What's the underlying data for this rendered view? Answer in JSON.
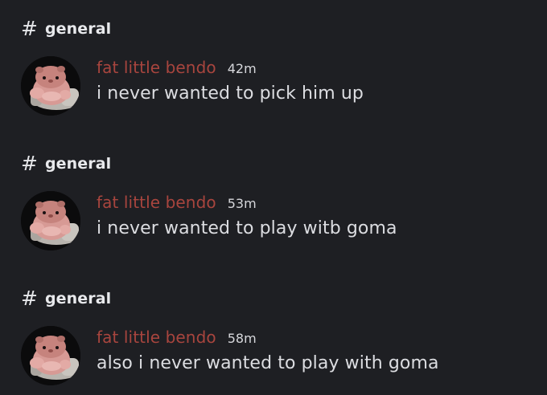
{
  "messages": [
    {
      "channel": "general",
      "author": "fat little bendo",
      "time": "42m",
      "text": "i never wanted to pick him up"
    },
    {
      "channel": "general",
      "author": "fat little bendo",
      "time": "53m",
      "text": "i never wanted to play witb goma"
    },
    {
      "channel": "general",
      "author": "fat little bendo",
      "time": "58m",
      "text": "also i never wanted to play with goma"
    }
  ],
  "icons": {
    "channel": "hash-icon",
    "avatar": "pink-hamster-on-armchair-avatar"
  },
  "colors": {
    "background": "#1e1f23",
    "author_name": "#a8453e",
    "message_text": "#dcdde1",
    "channel_text": "#e8e9ec"
  }
}
